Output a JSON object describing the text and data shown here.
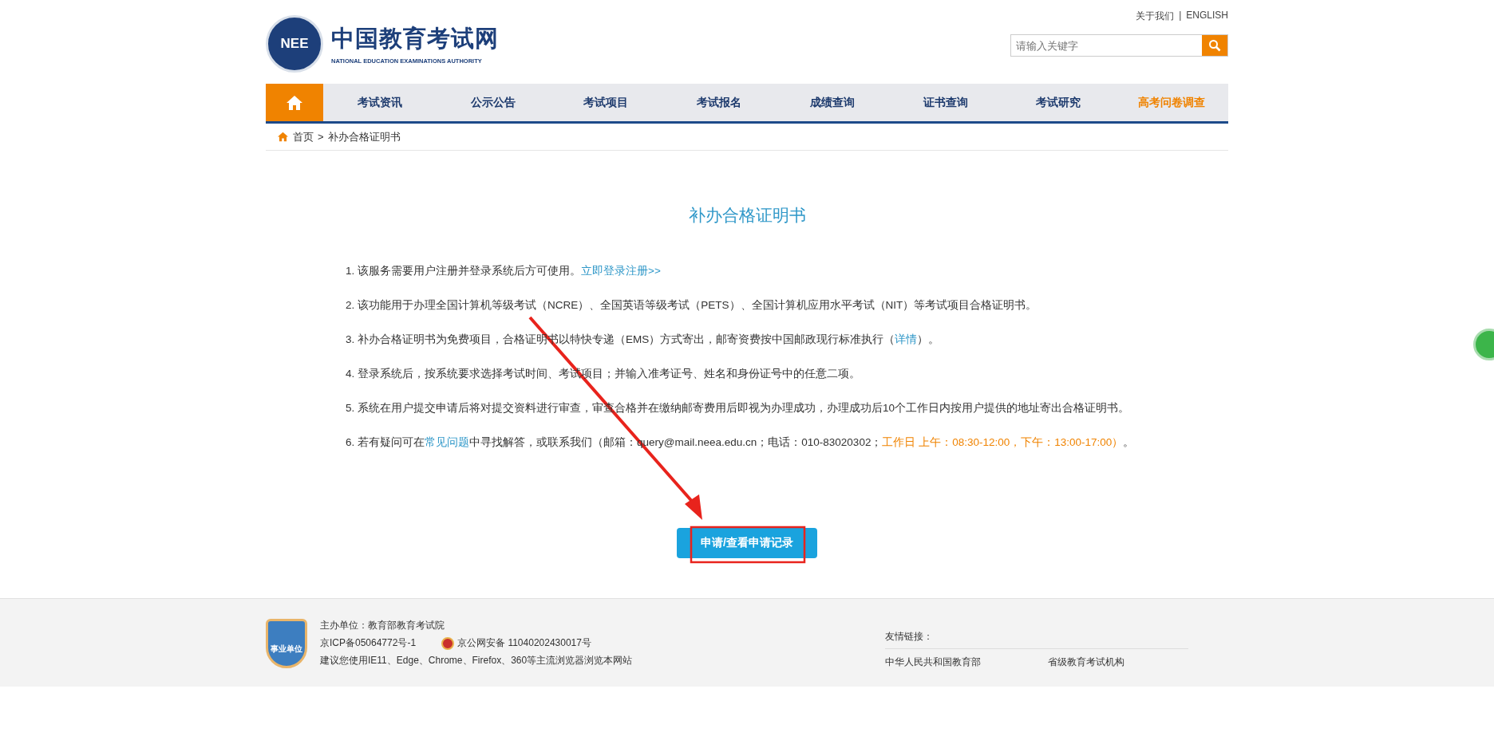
{
  "header": {
    "logo": {
      "emblem_text": "NEE",
      "title": "中国教育考试网",
      "subtitle": "NATIONAL EDUCATION EXAMINATIONS AUTHORITY"
    },
    "top_links": [
      "关于我们",
      "ENGLISH"
    ],
    "top_link_separator": "|",
    "search": {
      "placeholder": "请输入关键字"
    }
  },
  "nav": {
    "items": [
      {
        "label": "考试资讯",
        "kind": "normal"
      },
      {
        "label": "公示公告",
        "kind": "normal"
      },
      {
        "label": "考试项目",
        "kind": "normal"
      },
      {
        "label": "考试报名",
        "kind": "normal"
      },
      {
        "label": "成绩查询",
        "kind": "normal"
      },
      {
        "label": "证书查询",
        "kind": "normal"
      },
      {
        "label": "考试研究",
        "kind": "normal"
      },
      {
        "label": "高考问卷调查",
        "kind": "highlight"
      }
    ]
  },
  "breadcrumb": {
    "home": "首页",
    "separator": ">",
    "current": "补办合格证明书"
  },
  "page_title": "补办合格证明书",
  "items": [
    {
      "segments": [
        {
          "text": "1. 该服务需要用户注册并登录系统后方可使用。",
          "kind": "plain"
        },
        {
          "text": "立即登录注册>>",
          "kind": "link"
        }
      ]
    },
    {
      "segments": [
        {
          "text": "2. 该功能用于办理全国计算机等级考试（NCRE）、全国英语等级考试（PETS）、全国计算机应用水平考试（NIT）等考试项目合格证明书。",
          "kind": "plain"
        }
      ]
    },
    {
      "segments": [
        {
          "text": "3. 补办合格证明书为免费项目，合格证明书以特快专递（EMS）方式寄出，邮寄资费按中国邮政现行标准执行（",
          "kind": "plain"
        },
        {
          "text": "详情",
          "kind": "link"
        },
        {
          "text": "）。",
          "kind": "plain"
        }
      ]
    },
    {
      "segments": [
        {
          "text": "4. 登录系统后，按系统要求选择考试时间、考试项目；并输入准考证号、姓名和身份证号中的任意二项。",
          "kind": "plain"
        }
      ]
    },
    {
      "segments": [
        {
          "text": "5. 系统在用户提交申请后将对提交资料进行审查，审查合格并在缴纳邮寄费用后即视为办理成功，办理成功后10个工作日内按用户提供的地址寄出合格证明书。",
          "kind": "plain"
        }
      ]
    },
    {
      "segments": [
        {
          "text": "6. 若有疑问可在",
          "kind": "plain"
        },
        {
          "text": "常见问题",
          "kind": "link"
        },
        {
          "text": "中寻找解答，或联系我们（邮箱：query@mail.neea.edu.cn；电话：010-83020302；",
          "kind": "plain"
        },
        {
          "text": "工作日 上午：08:30-12:00，下午：13:00-17:00）",
          "kind": "highlight"
        },
        {
          "text": "。",
          "kind": "plain"
        }
      ]
    }
  ],
  "apply_button": "申请/查看申请记录",
  "annotation": {
    "arrow": true,
    "highlight_box": true
  },
  "footer": {
    "badge_text": "事业单位",
    "host": "主办单位：教育部教育考试院",
    "icp": "京ICP备05064772号-1",
    "police": "京公网安备 11040202430017号",
    "browser_note": "建议您使用IE11、Edge、Chrome、Firefox、360等主流浏览器浏览本网站",
    "links_title": "友情链接：",
    "links": [
      "中华人民共和国教育部",
      "省级教育考试机构"
    ]
  }
}
